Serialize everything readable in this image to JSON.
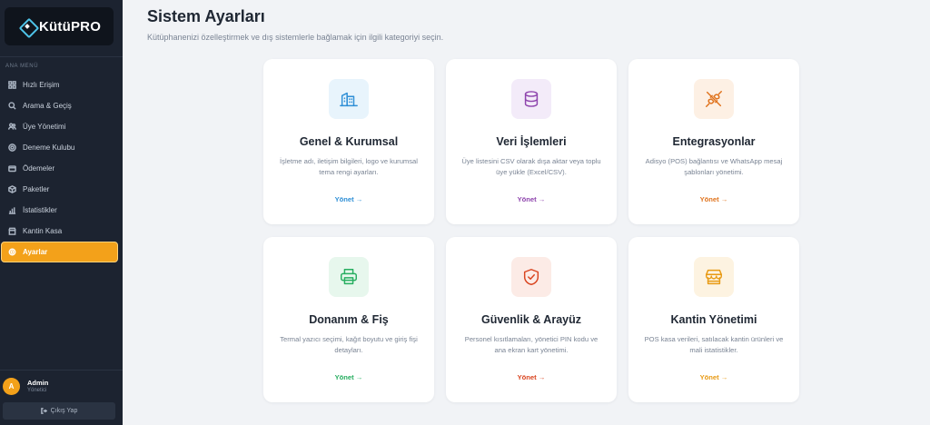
{
  "app": {
    "logo_text": "KütüPRO"
  },
  "sidebar": {
    "menu_title": "ANA MENÜ",
    "items": [
      {
        "label": "Hızlı Erişim",
        "icon": "grid-icon"
      },
      {
        "label": "Arama & Geçiş",
        "icon": "search-icon"
      },
      {
        "label": "Üye Yönetimi",
        "icon": "users-icon"
      },
      {
        "label": "Deneme Kulubu",
        "icon": "target-icon"
      },
      {
        "label": "Ödemeler",
        "icon": "wallet-icon"
      },
      {
        "label": "Paketler",
        "icon": "box-icon"
      },
      {
        "label": "İstatistikler",
        "icon": "chart-icon"
      },
      {
        "label": "Kantin Kasa",
        "icon": "store-icon"
      },
      {
        "label": "Ayarlar",
        "icon": "gear-icon",
        "active": true
      }
    ],
    "user": {
      "initial": "A",
      "name": "Admin",
      "role": "Yönetici"
    },
    "logout_label": "Çıkış Yap"
  },
  "main": {
    "title": "Sistem Ayarları",
    "subtitle": "Kütüphanenizi özelleştirmek ve dış sistemlerle bağlamak için ilgili kategoriyi seçin.",
    "cards": [
      {
        "title": "Genel & Kurumsal",
        "desc": "İşletme adı, iletişim bilgileri, logo ve kurumsal tema rengi ayarları.",
        "link": "Yönet →",
        "icon": "building-icon",
        "color": "#2f8fd6",
        "bg": "#e8f4fc"
      },
      {
        "title": "Veri İşlemleri",
        "desc": "Üye listesini CSV olarak dışa aktar veya toplu üye yükle (Excel/CSV).",
        "link": "Yönet →",
        "icon": "database-icon",
        "color": "#8e44ad",
        "bg": "#f3ebf9"
      },
      {
        "title": "Entegrasyonlar",
        "desc": "Adisyo (POS) bağlantısı ve WhatsApp mesaj şablonları yönetimi.",
        "link": "Yönet →",
        "icon": "plug-icon",
        "color": "#e0741f",
        "bg": "#fdf0e4"
      },
      {
        "title": "Donanım & Fiş",
        "desc": "Termal yazıcı seçimi, kağıt boyutu ve giriş fişi detayları.",
        "link": "Yönet →",
        "icon": "printer-icon",
        "color": "#27ae60",
        "bg": "#e7f7ed"
      },
      {
        "title": "Güvenlik & Arayüz",
        "desc": "Personel kısıtlamaları, yönetici PIN kodu ve ana ekran kart yönetimi.",
        "link": "Yönet →",
        "icon": "shield-check-icon",
        "color": "#d9441f",
        "bg": "#fcebe6"
      },
      {
        "title": "Kantin Yönetimi",
        "desc": "POS kasa verileri, satılacak kantin ürünleri ve mali istatistikler.",
        "link": "Yönet →",
        "icon": "shop-icon",
        "color": "#e89a14",
        "bg": "#fdf3e1"
      }
    ]
  }
}
